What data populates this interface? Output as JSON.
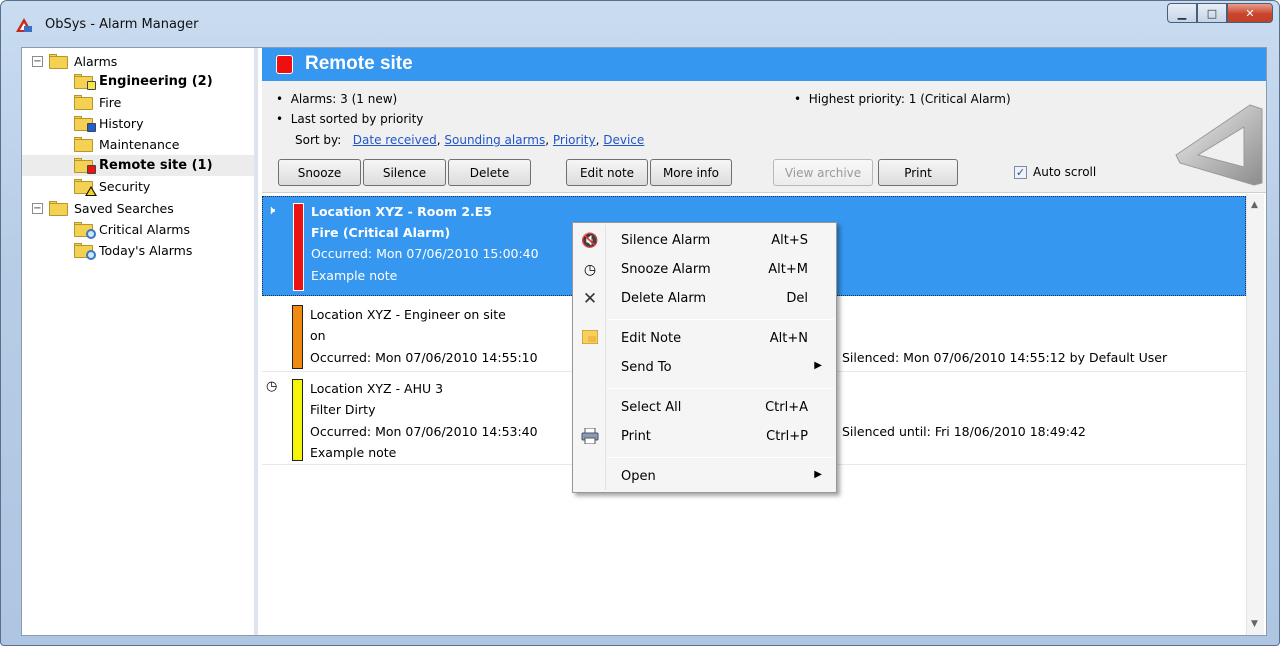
{
  "window": {
    "title": "ObSys - Alarm Manager"
  },
  "sidebar": {
    "items": [
      {
        "label": "Alarms"
      },
      {
        "label": "Engineering (2)"
      },
      {
        "label": "Fire"
      },
      {
        "label": "History"
      },
      {
        "label": "Maintenance"
      },
      {
        "label": "Remote site (1)"
      },
      {
        "label": "Security"
      },
      {
        "label": "Saved Searches"
      },
      {
        "label": "Critical Alarms"
      },
      {
        "label": "Today's Alarms"
      }
    ]
  },
  "header": {
    "title": "Remote site",
    "color": "#3597ef",
    "swatch_color": "#ef0f0f"
  },
  "info": {
    "alarms": "Alarms: 3 (1 new)",
    "last_sorted": "Last sorted by priority",
    "highest_priority": "Highest priority: 1 (Critical Alarm)",
    "sort_by_label": "Sort by:",
    "sort_links": [
      "Date received",
      "Sounding alarms",
      "Priority",
      "Device"
    ]
  },
  "toolbar": {
    "snooze": "Snooze",
    "silence": "Silence",
    "delete": "Delete",
    "edit_note": "Edit note",
    "more_info": "More info",
    "view_archive": "View archive",
    "print": "Print",
    "auto_scroll": "Auto scroll",
    "auto_scroll_checked": true
  },
  "alarms": [
    {
      "location": "Location XYZ - Room 2.E5",
      "description": "Fire  (Critical Alarm)",
      "occurred": "Occurred: Mon 07/06/2010 15:00:40",
      "note": "Example note",
      "priority_color": "#ee1111",
      "icon": "speaker-icon",
      "status": ""
    },
    {
      "location": "Location XYZ - Engineer on site",
      "description": "on",
      "occurred": "Occurred: Mon 07/06/2010 14:55:10",
      "note": "",
      "priority_color": "#f08a10",
      "icon": "",
      "status": "Silenced: Mon 07/06/2010 14:55:12 by Default User"
    },
    {
      "location": "Location XYZ - AHU 3",
      "description": "Filter Dirty",
      "occurred": "Occurred: Mon 07/06/2010 14:53:40",
      "note": "Example note",
      "priority_color": "#f5f50a",
      "icon": "clock-icon",
      "status": "Silenced until: Fri 18/06/2010 18:49:42"
    }
  ],
  "context_menu": {
    "items": [
      {
        "label": "Silence Alarm",
        "shortcut": "Alt+S",
        "icon": "mute-icon"
      },
      {
        "label": "Snooze Alarm",
        "shortcut": "Alt+M",
        "icon": "clock-icon"
      },
      {
        "label": "Delete Alarm",
        "shortcut": "Del",
        "icon": "delete-icon"
      },
      {
        "label": "Edit Note",
        "shortcut": "Alt+N",
        "icon": "note-icon"
      },
      {
        "label": "Send To",
        "shortcut": "",
        "icon": ""
      },
      {
        "label": "Select All",
        "shortcut": "Ctrl+A",
        "icon": ""
      },
      {
        "label": "Print",
        "shortcut": "Ctrl+P",
        "icon": "printer-icon"
      },
      {
        "label": "Open",
        "shortcut": "",
        "icon": ""
      }
    ]
  }
}
